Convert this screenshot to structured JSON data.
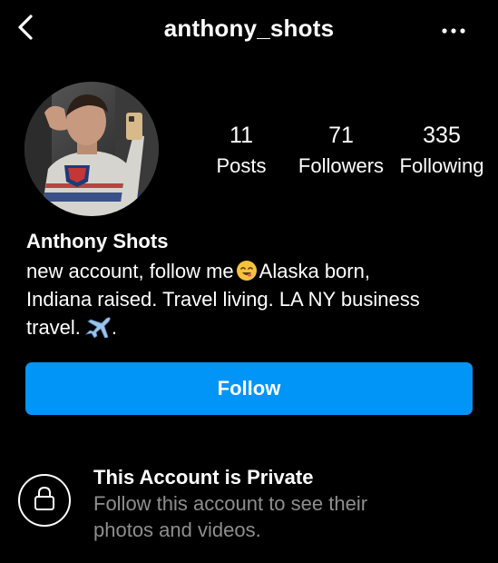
{
  "header": {
    "username": "anthony_shots",
    "back_icon": "chevron-left-icon",
    "more_icon": "more-horizontal-icon"
  },
  "profile": {
    "avatar_icon": "profile-photo",
    "stats": {
      "posts": {
        "value": "11",
        "label": "Posts"
      },
      "followers": {
        "value": "71",
        "label": "Followers"
      },
      "following": {
        "value": "335",
        "label": "Following"
      }
    },
    "display_name": "Anthony Shots",
    "bio": {
      "line1_a": "new account, follow me",
      "line1_b": "Alaska born,",
      "line2": "Indiana raised. Travel living. LA NY business",
      "line3_a": "travel.",
      "line3_b": ".",
      "emoji_1": "smiling-face-emoji",
      "emoji_2": "airplane-emoji"
    }
  },
  "actions": {
    "follow_label": "Follow"
  },
  "private_notice": {
    "icon": "lock-icon",
    "title": "This Account is Private",
    "subtitle_line1": "Follow this account to see their",
    "subtitle_line2": "photos and videos."
  },
  "colors": {
    "background": "#000000",
    "text": "#ffffff",
    "muted_text": "#8e8e8e",
    "accent": "#0095f6"
  }
}
